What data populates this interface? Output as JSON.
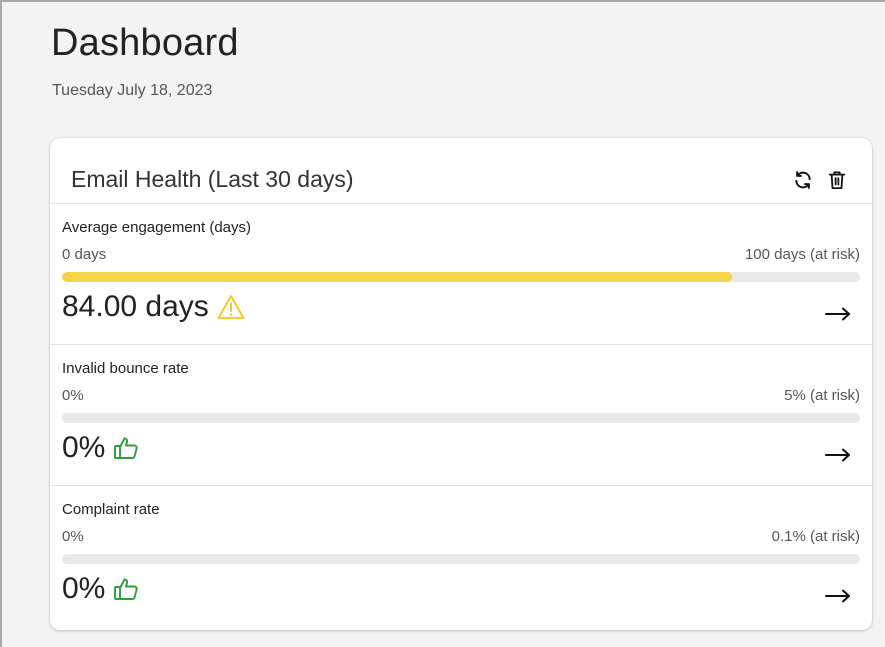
{
  "page": {
    "title": "Dashboard",
    "date": "Tuesday July 18, 2023"
  },
  "card": {
    "title": "Email Health (Last 30 days)",
    "tools": {
      "refresh_icon": "refresh-icon",
      "delete_icon": "trash-icon"
    }
  },
  "metrics": [
    {
      "label": "Average engagement (days)",
      "scale_min": "0 days",
      "scale_max": "100 days (at risk)",
      "progress_fraction": 0.84,
      "value": "84.00 days",
      "status_icon": "warning-icon",
      "bar_color": "#f5d547"
    },
    {
      "label": "Invalid bounce rate",
      "scale_min": "0%",
      "scale_max": "5% (at risk)",
      "progress_fraction": 0,
      "value": "0%",
      "status_icon": "thumbs-up-icon"
    },
    {
      "label": "Complaint rate",
      "scale_min": "0%",
      "scale_max": "0.1% (at risk)",
      "progress_fraction": 0,
      "value": "0%",
      "status_icon": "thumbs-up-icon"
    }
  ],
  "colors": {
    "warning": "#f5c518",
    "good": "#2e9e3a",
    "track": "#e8e8e8"
  }
}
